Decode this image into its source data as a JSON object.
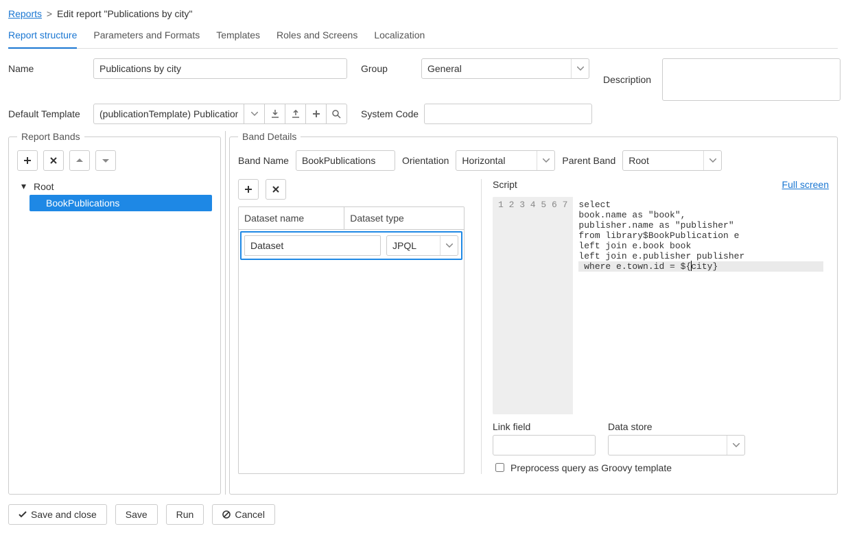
{
  "breadcrumb": {
    "root_link": "Reports",
    "current": "Edit report \"Publications by city\""
  },
  "tabs": [
    {
      "label": "Report structure",
      "active": true
    },
    {
      "label": "Parameters and Formats"
    },
    {
      "label": "Templates"
    },
    {
      "label": "Roles and Screens"
    },
    {
      "label": "Localization"
    }
  ],
  "form": {
    "name_label": "Name",
    "name_value": "Publications by city",
    "group_label": "Group",
    "group_value": "General",
    "description_label": "Description",
    "description_value": "",
    "default_template_label": "Default Template",
    "default_template_value": "(publicationTemplate) Publication",
    "system_code_label": "System Code",
    "system_code_value": ""
  },
  "report_bands": {
    "legend": "Report Bands",
    "tree": {
      "root_label": "Root",
      "children": [
        {
          "label": "BookPublications",
          "selected": true
        }
      ]
    }
  },
  "band_details": {
    "legend": "Band Details",
    "band_name_label": "Band Name",
    "band_name_value": "BookPublications",
    "orientation_label": "Orientation",
    "orientation_value": "Horizontal",
    "parent_band_label": "Parent Band",
    "parent_band_value": "Root",
    "datasets": {
      "headers": {
        "name": "Dataset name",
        "type": "Dataset type"
      },
      "row": {
        "name_value": "Dataset",
        "type_value": "JPQL"
      }
    },
    "script_label": "Script",
    "full_screen_label": "Full screen",
    "script_lines": [
      "select",
      "book.name as \"book\",",
      "publisher.name as \"publisher\"",
      "from library$BookPublication e",
      "left join e.book book",
      "left join e.publisher publisher",
      " where e.town.id = ${city}"
    ],
    "current_line_index": 6,
    "link_field_label": "Link field",
    "link_field_value": "",
    "data_store_label": "Data store",
    "data_store_value": "",
    "preprocess_label": "Preprocess query as Groovy template",
    "preprocess_checked": false
  },
  "footer": {
    "save_close": "Save and close",
    "save": "Save",
    "run": "Run",
    "cancel": "Cancel"
  }
}
